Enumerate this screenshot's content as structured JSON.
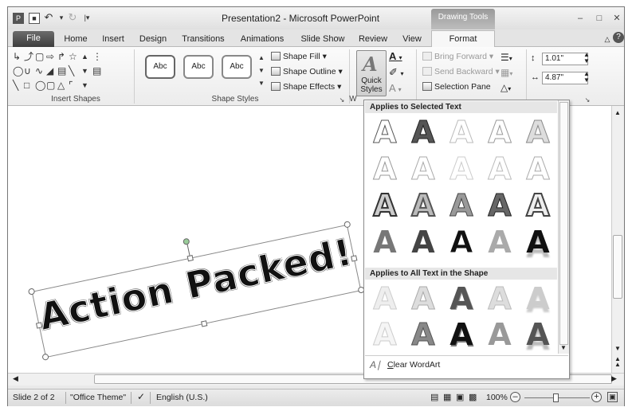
{
  "window": {
    "title": "Presentation2  -  Microsoft PowerPoint",
    "contextual_group": "Drawing Tools"
  },
  "tabs": [
    "File",
    "Home",
    "Insert",
    "Design",
    "Transitions",
    "Animations",
    "Slide Show",
    "Review",
    "View",
    "Format"
  ],
  "ribbon": {
    "groups": {
      "insert_shapes": "Insert Shapes",
      "shape_styles": "Shape Styles",
      "wordart_styles": "W"
    },
    "style_boxes": [
      "Abc",
      "Abc",
      "Abc"
    ],
    "shape_fill": "Shape Fill",
    "shape_outline": "Shape Outline",
    "shape_effects": "Shape Effects",
    "quick_styles_line1": "Quick",
    "quick_styles_line2": "Styles",
    "bring_forward": "Bring Forward",
    "send_backward": "Send Backward",
    "selection_pane": "Selection Pane",
    "height_value": "1.01\"",
    "width_value": "4.87\""
  },
  "slide": {
    "wordart_text": "Action Packed!"
  },
  "gallery": {
    "section1_title": "Applies to Selected Text",
    "section2_title": "Applies to All Text in the Shape",
    "glyph": "A",
    "clear_label": "Clear WordArt",
    "clear_underline_char": "C"
  },
  "status": {
    "slide": "Slide 2 of 2",
    "theme": "\"Office Theme\"",
    "language": "English (U.S.)",
    "zoom": "100%"
  }
}
